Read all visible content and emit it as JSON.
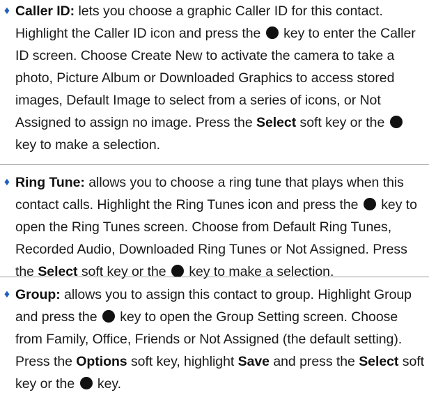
{
  "bullet_glyph": "♦",
  "key_icon": "black-circle-ok-key-icon",
  "items": [
    {
      "lines": [
        [
          {
            "t": "Caller ID:",
            "b": true
          },
          {
            "t": " lets you choose a graphic Caller ID for this contact."
          }
        ],
        [
          {
            "t": "Highlight the Caller ID icon and press the "
          },
          {
            "icon": "ok-key"
          },
          {
            "t": " key to enter the Caller"
          }
        ],
        [
          {
            "t": "ID screen. Choose Create New to activate the camera to take a"
          }
        ],
        [
          {
            "t": "photo, Picture Album or Downloaded Graphics to access stored"
          }
        ],
        [
          {
            "t": "images, Default Image to select from a series of icons, or Not"
          }
        ],
        [
          {
            "t": "Assigned to assign no image. Press the "
          },
          {
            "t": "Select",
            "b": true
          },
          {
            "t": " soft key or the "
          },
          {
            "icon": "ok-key"
          }
        ],
        [
          {
            "t": "key to make a selection."
          }
        ]
      ]
    },
    {
      "lines": [
        [
          {
            "t": "Ring Tune:",
            "b": true
          },
          {
            "t": " allows you to choose a ring tune that plays when this"
          }
        ],
        [
          {
            "t": "contact calls. Highlight the Ring Tunes icon and press the "
          },
          {
            "icon": "ok-key"
          },
          {
            "t": " key to"
          }
        ],
        [
          {
            "t": "open the Ring Tunes screen. Choose from Default Ring Tunes,"
          }
        ],
        [
          {
            "t": "Recorded Audio, Downloaded Ring Tunes or Not Assigned. Press"
          }
        ],
        [
          {
            "t": "the "
          },
          {
            "t": "Select",
            "b": true
          },
          {
            "t": " soft key or the "
          },
          {
            "icon": "ok-key"
          },
          {
            "t": " key to make a selection."
          }
        ]
      ]
    },
    {
      "lines": [
        [
          {
            "t": "Group:",
            "b": true
          },
          {
            "t": " allows you to assign this contact to group. Highlight Group"
          }
        ],
        [
          {
            "t": "and press the "
          },
          {
            "icon": "ok-key"
          },
          {
            "t": " key to open the Group Setting screen. Choose"
          }
        ],
        [
          {
            "t": "from Family, Office, Friends or Not Assigned (the default setting)."
          }
        ],
        [
          {
            "t": "Press the "
          },
          {
            "t": "Options",
            "b": true
          },
          {
            "t": " soft key, highlight "
          },
          {
            "t": "Save",
            "b": true
          },
          {
            "t": " and press the "
          },
          {
            "t": "Select",
            "b": true
          },
          {
            "t": " soft"
          }
        ],
        [
          {
            "t": "key or the "
          },
          {
            "icon": "ok-key"
          },
          {
            "t": " key."
          }
        ]
      ]
    }
  ]
}
